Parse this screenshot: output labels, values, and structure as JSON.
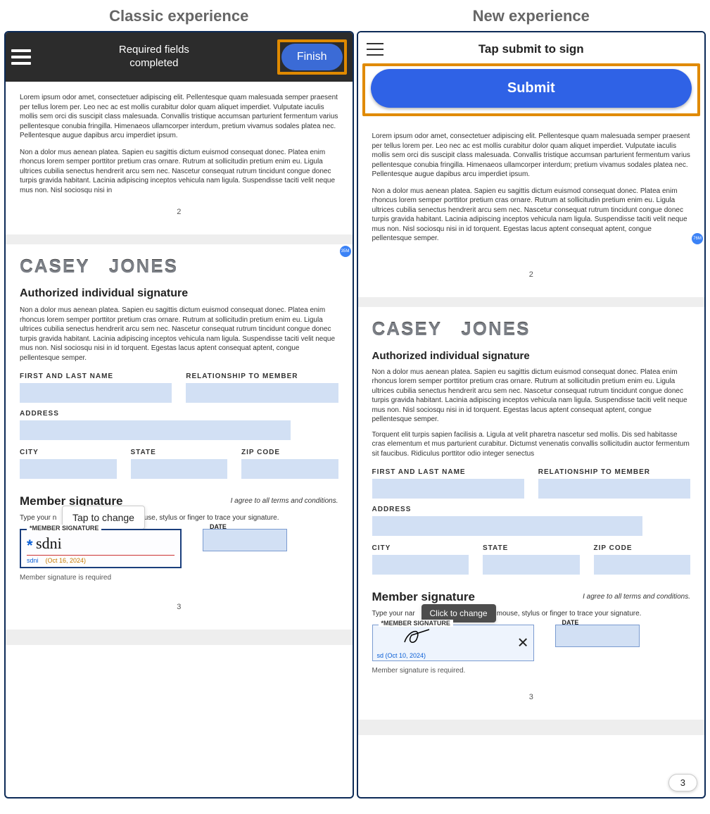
{
  "titles": {
    "classic": "Classic experience",
    "new": "New experience"
  },
  "classic": {
    "header_line1": "Required fields",
    "header_line2": "completed",
    "finish_label": "Finish",
    "lorem1": "Lorem ipsum odor amet, consectetuer adipiscing elit. Pellentesque quam malesuada semper praesent per tellus lorem per. Leo nec ac est mollis curabitur dolor quam aliquet imperdiet. Vulputate iaculis mollis sem orci dis suscipit class malesuada. Convallis tristique accumsan parturient fermentum varius pellentesque conubia fringilla. Himenaeos ullamcorper interdum, pretium vivamus sodales platea nec. Pellentesque augue dapibus arcu imperdiet ipsum.",
    "lorem2": "Non a dolor mus aenean platea. Sapien eu sagittis dictum euismod consequat donec. Platea enim rhoncus lorem semper porttitor pretium cras ornare. Rutrum at sollicitudin pretium enim eu. Ligula ultrices cubilia senectus hendrerit arcu sem nec. Nascetur consequat rutrum tincidunt congue donec turpis gravida habitant. Lacinia adipiscing inceptos vehicula nam ligula. Suspendisse taciti velit neque mus non. Nisl sociosqu nisi in",
    "page2_num": "2",
    "casey": "CASEY   JONES",
    "sec_title": "Authorized individual signature",
    "para": "Non a dolor mus aenean platea. Sapien eu sagittis dictum euismod consequat donec. Platea enim rhoncus lorem semper porttitor pretium cras ornare. Rutrum at sollicitudin pretium enim eu. Ligula ultrices cubilia senectus hendrerit arcu sem nec. Nascetur consequat rutrum tincidunt congue donec turpis gravida habitant. Lacinia adipiscing inceptos vehicula nam ligula. Suspendisse taciti velit neque mus non. Nisl sociosqu nisi in id torquent. Egestas lacus aptent consequat aptent, congue pellentesque semper.",
    "labels": {
      "name": "FIRST AND LAST NAME",
      "rel": "RELATIONSHIP TO MEMBER",
      "address": "ADDRESS",
      "city": "CITY",
      "state": "STATE",
      "zip": "ZIP CODE"
    },
    "member_sig_title": "Member signature",
    "agree": "I agree to all terms and conditions.",
    "instr_pre": "Type your n",
    "instr_post": "e your mouse, stylus or finger to trace your signature.",
    "tooltip": "Tap to change",
    "sig_legend": "*MEMBER SIGNATURE",
    "sig_value": "sdni",
    "sig_sub_name": "sdni",
    "sig_sub_date": "(Oct 16, 2024)",
    "date_legend": "DATE",
    "req_msg": "Member signature is required",
    "page3_num": "3",
    "badge": "35M"
  },
  "new": {
    "header_title": "Tap submit to sign",
    "submit_label": "Submit",
    "crumb": "",
    "lorem1": "Lorem ipsum odor amet, consectetuer adipiscing elit. Pellentesque quam malesuada semper praesent per tellus lorem per. Leo nec ac est mollis curabitur dolor quam aliquet imperdiet. Vulputate iaculis mollis sem orci dis suscipit class malesuada. Convallis tristique accumsan parturient fermentum varius pellentesque conubia fringilla. Himenaeos ullamcorper interdum; pretium vivamus sodales platea nec. Pellentesque augue dapibus arcu imperdiet ipsum.",
    "lorem2": "Non a dolor mus aenean platea. Sapien eu sagittis dictum euismod consequat donec. Platea enim rhoncus lorem semper porttitor pretium cras ornare. Rutrum at sollicitudin pretium enim eu. Ligula ultrices cubilia senectus hendrerit arcu sem nec. Nascetur consequat rutrum tincidunt congue donec turpis gravida habitant. Lacinia adipiscing inceptos vehicula nam ligula. Suspendisse taciti velit neque mus non. Nisl sociosqu nisi in id torquent. Egestas lacus aptent consequat aptent, congue pellentesque semper.",
    "page2_num": "2",
    "casey": "CASEY   JONES",
    "sec_title": "Authorized individual signature",
    "para1": "Non a dolor mus aenean platea. Sapien eu sagittis dictum euismod consequat donec. Platea enim rhoncus lorem semper porttitor pretium cras ornare. Rutrum at sollicitudin pretium enim eu. Ligula ultrices cubilia senectus hendrerit arcu sem nec. Nascetur consequat rutrum tincidunt congue donec turpis gravida habitant. Lacinia adipiscing inceptos vehicula nam ligula. Suspendisse taciti velit neque mus non. Nisl sociosqu nisi in id torquent. Egestas lacus aptent consequat aptent, congue pellentesque semper.",
    "para2": "Torquent elit turpis sapien facilisis a. Ligula at velit pharetra nascetur sed mollis. Dis sed habitasse cras elementum et mus parturient curabitur. Dictumst venenatis convallis sollicitudin auctor fermentum sit faucibus. Ridiculus porttitor odio integer senectus",
    "labels": {
      "name": "FIRST AND LAST NAME",
      "rel": "RELATIONSHIP TO MEMBER",
      "address": "ADDRESS",
      "city": "CITY",
      "state": "STATE",
      "zip": "ZIP CODE"
    },
    "member_sig_title": "Member signature",
    "agree": "I agree to all terms and conditions.",
    "instr_pre": "Type your nar",
    "instr_post": "use your mouse, stylus or finger to trace your signature.",
    "tooltip": "Click to change",
    "sig_legend": "*MEMBER SIGNATURE",
    "sig_sub": "sd (Oct 10, 2024)",
    "date_legend": "DATE",
    "req_msg": "Member signature is required.",
    "page3_num": "3",
    "fab": "3",
    "badge": "76M"
  }
}
